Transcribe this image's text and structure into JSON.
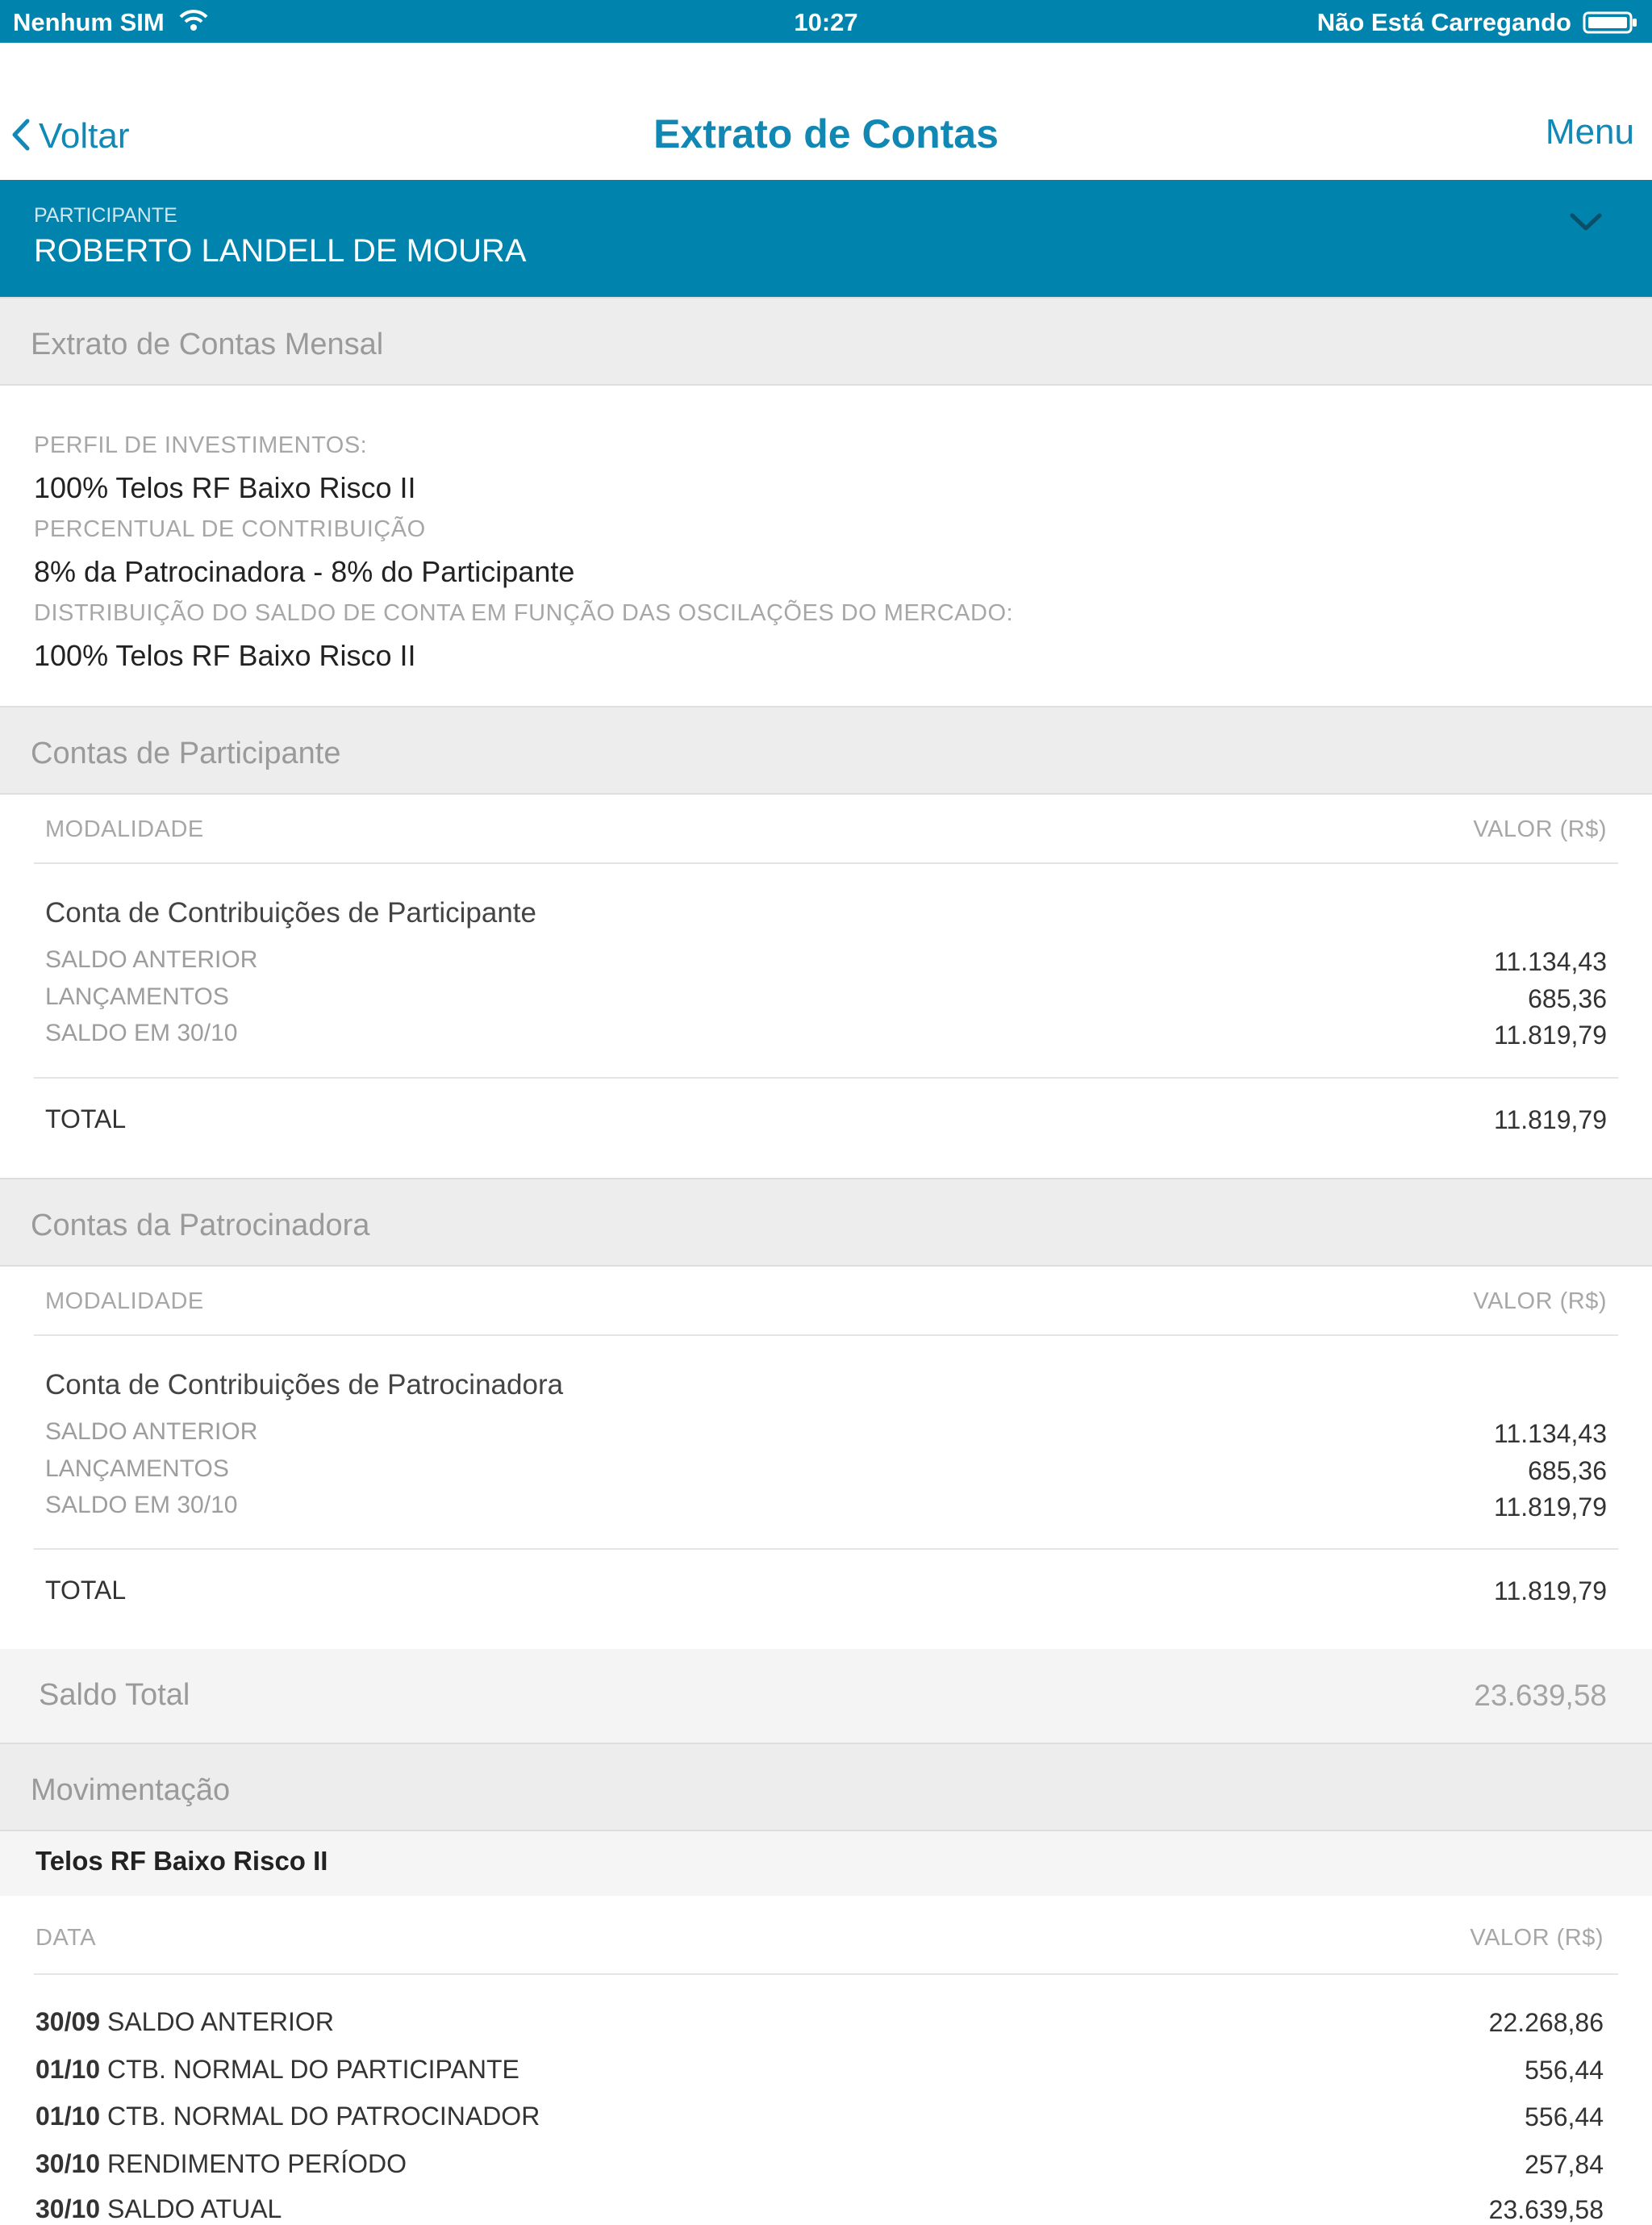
{
  "status_bar": {
    "carrier": "Nenhum SIM",
    "time": "10:27",
    "battery_text": "Não Está Carregando"
  },
  "nav": {
    "back_label": "Voltar",
    "title": "Extrato de Contas",
    "menu_label": "Menu"
  },
  "participant": {
    "label": "PARTICIPANTE",
    "name": "ROBERTO LANDELL DE MOURA"
  },
  "monthly": {
    "header": "Extrato de Contas Mensal",
    "fields": [
      {
        "label": "PERFIL DE INVESTIMENTOS:",
        "value": "100% Telos RF Baixo Risco II"
      },
      {
        "label": "PERCENTUAL DE CONTRIBUIÇÃO",
        "value": "8% da Patrocinadora - 8% do Participante"
      },
      {
        "label": "DISTRIBUIÇÃO DO SALDO DE CONTA EM FUNÇÃO DAS OSCILAÇÕES DO MERCADO:",
        "value": "100% Telos RF Baixo Risco II"
      }
    ]
  },
  "participant_accounts": {
    "header": "Contas de Participante",
    "col_modalidade": "MODALIDADE",
    "col_valor": "VALOR (R$)",
    "account_name": "Conta de Contribuições de Participante",
    "rows": [
      {
        "label": "SALDO ANTERIOR",
        "value": "11.134,43"
      },
      {
        "label": "LANÇAMENTOS",
        "value": "685,36"
      },
      {
        "label": "SALDO EM 30/10",
        "value": "11.819,79"
      }
    ],
    "total_label": "TOTAL",
    "total_value": "11.819,79"
  },
  "sponsor_accounts": {
    "header": "Contas da Patrocinadora",
    "col_modalidade": "MODALIDADE",
    "col_valor": "VALOR (R$)",
    "account_name": "Conta de Contribuições de Patrocinadora",
    "rows": [
      {
        "label": "SALDO ANTERIOR",
        "value": "11.134,43"
      },
      {
        "label": "LANÇAMENTOS",
        "value": "685,36"
      },
      {
        "label": "SALDO EM 30/10",
        "value": "11.819,79"
      }
    ],
    "total_label": "TOTAL",
    "total_value": "11.819,79"
  },
  "saldo_total": {
    "label": "Saldo Total",
    "value": "23.639,58"
  },
  "movimentacao": {
    "header": "Movimentação",
    "fund_name": "Telos RF Baixo Risco II",
    "col_data": "DATA",
    "col_valor": "VALOR (R$)",
    "rows": [
      {
        "date": "30/09",
        "desc": "SALDO ANTERIOR",
        "value": "22.268,86"
      },
      {
        "date": "01/10",
        "desc": "CTB. NORMAL DO PARTICIPANTE",
        "value": "556,44"
      },
      {
        "date": "01/10",
        "desc": "CTB. NORMAL DO PATROCINADOR",
        "value": "556,44"
      },
      {
        "date": "30/10",
        "desc": "RENDIMENTO PERÍODO",
        "value": "257,84"
      },
      {
        "date": "30/10",
        "desc": "SALDO ATUAL",
        "value": "23.639,58"
      }
    ]
  },
  "colors": {
    "brand_blue": "#0083ad",
    "link_blue": "#1188b6",
    "section_gray": "#ededed"
  }
}
